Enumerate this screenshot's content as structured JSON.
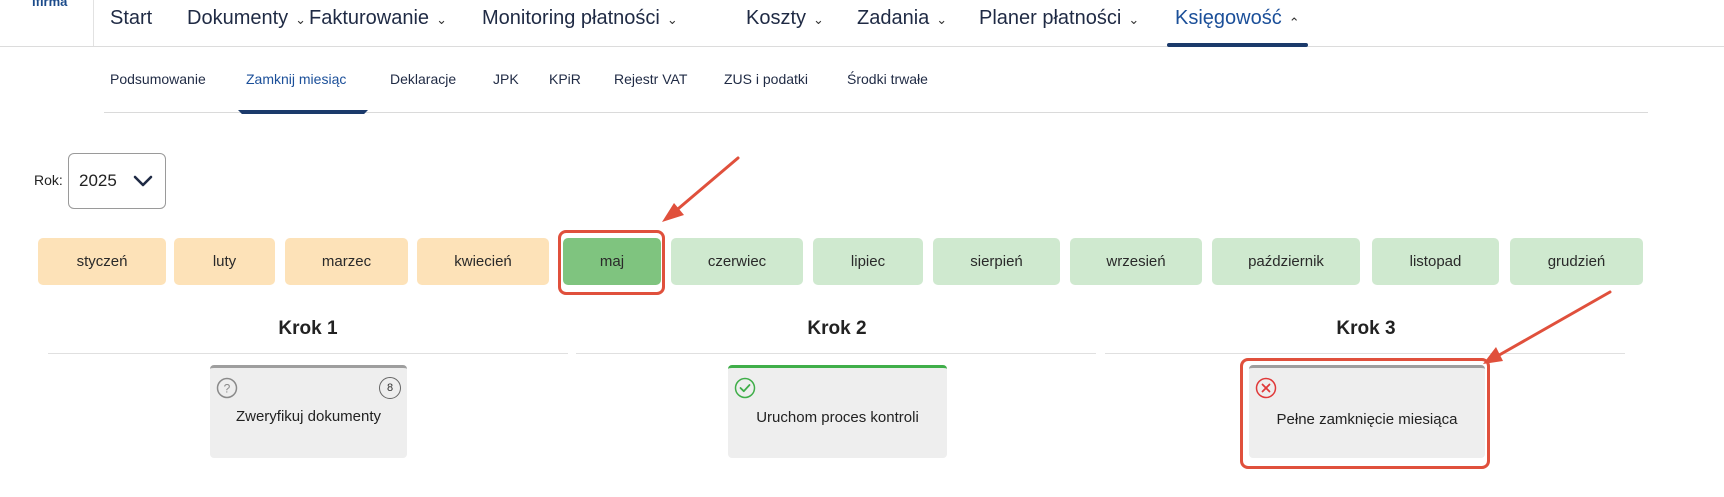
{
  "logo": {
    "text": "ifirma"
  },
  "topnav": [
    {
      "label": "Start",
      "chevron": ""
    },
    {
      "label": "Dokumenty",
      "chevron": "⌄"
    },
    {
      "label": "Fakturowanie",
      "chevron": "⌄"
    },
    {
      "label": "Monitoring płatności",
      "chevron": "⌄"
    },
    {
      "label": "Koszty",
      "chevron": "⌄"
    },
    {
      "label": "Zadania",
      "chevron": "⌄"
    },
    {
      "label": "Planer płatności",
      "chevron": "⌄"
    },
    {
      "label": "Księgowość",
      "chevron": "⌃"
    }
  ],
  "subnav": [
    {
      "label": "Podsumowanie"
    },
    {
      "label": "Zamknij miesiąc"
    },
    {
      "label": "Deklaracje"
    },
    {
      "label": "JPK"
    },
    {
      "label": "KPiR"
    },
    {
      "label": "Rejestr VAT"
    },
    {
      "label": "ZUS i podatki"
    },
    {
      "label": "Środki trwałe"
    }
  ],
  "year": {
    "label": "Rok:",
    "value": "2025"
  },
  "months": [
    {
      "label": "styczeń",
      "status": "past"
    },
    {
      "label": "luty",
      "status": "past"
    },
    {
      "label": "marzec",
      "status": "past"
    },
    {
      "label": "kwiecień",
      "status": "past"
    },
    {
      "label": "maj",
      "status": "current"
    },
    {
      "label": "czerwiec",
      "status": "future"
    },
    {
      "label": "lipiec",
      "status": "future"
    },
    {
      "label": "sierpień",
      "status": "future"
    },
    {
      "label": "wrzesień",
      "status": "future"
    },
    {
      "label": "październik",
      "status": "future"
    },
    {
      "label": "listopad",
      "status": "future"
    },
    {
      "label": "grudzień",
      "status": "future"
    }
  ],
  "steps": [
    {
      "title": "Krok 1",
      "card_label": "Zweryfikuj dokumenty",
      "icon": "question-icon",
      "count": "8"
    },
    {
      "title": "Krok 2",
      "card_label": "Uruchom proces kontroli",
      "icon": "check-icon"
    },
    {
      "title": "Krok 3",
      "card_label": "Pełne zamknięcie miesiąca",
      "icon": "error-icon"
    }
  ],
  "colors": {
    "accent": "#1b3a6b",
    "month_past": "#fde2b8",
    "month_future": "#cfe9cf",
    "month_current": "#7fc47f",
    "card_top_gray": "#9e9e9e",
    "card_top_green": "#3fae49",
    "error": "#e03a3a",
    "annotation": "#e0503c"
  }
}
